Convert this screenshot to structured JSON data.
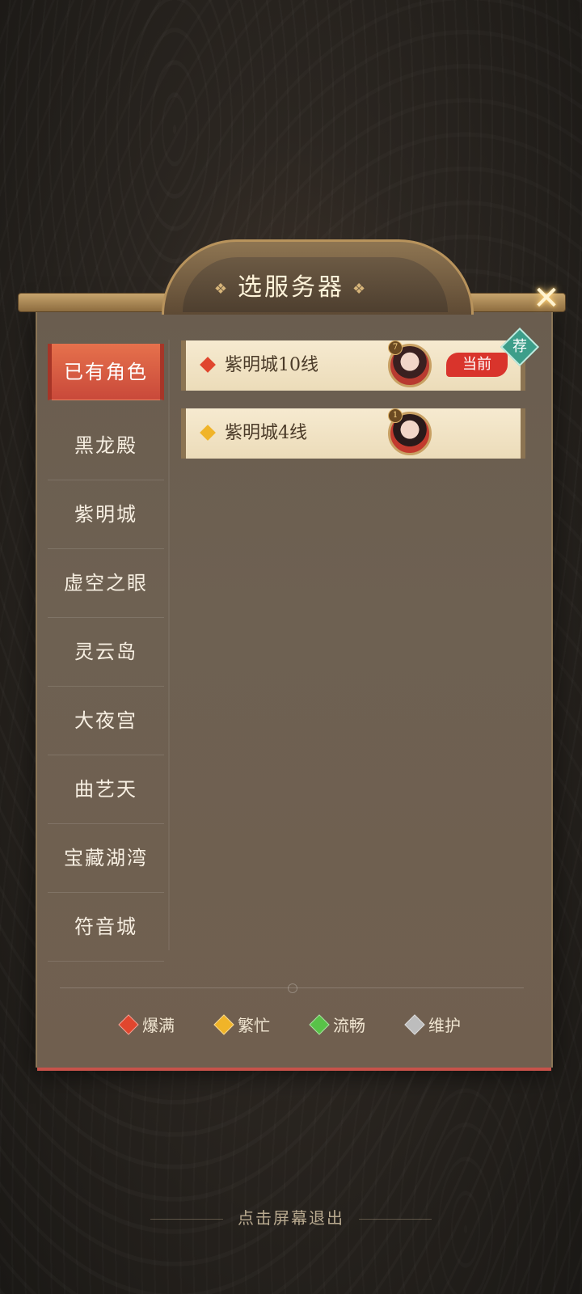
{
  "window": {
    "title": "选服务器"
  },
  "close_label": "✕",
  "sidebar": {
    "items": [
      {
        "label": "已有角色",
        "active": true
      },
      {
        "label": "黑龙殿"
      },
      {
        "label": "紫明城"
      },
      {
        "label": "虚空之眼"
      },
      {
        "label": "灵云岛"
      },
      {
        "label": "大夜宫"
      },
      {
        "label": "曲艺天"
      },
      {
        "label": "宝藏湖湾"
      },
      {
        "label": "符音城"
      }
    ]
  },
  "servers": [
    {
      "name": "紫明城10线",
      "status": "爆满",
      "status_color": "#e0462e",
      "level": "7",
      "badge": "当前"
    },
    {
      "name": "紫明城4线",
      "status": "繁忙",
      "status_color": "#f0b429",
      "level": "1"
    }
  ],
  "recommend_badge": "荐",
  "legend": [
    {
      "label": "爆满",
      "color": "#e0462e"
    },
    {
      "label": "繁忙",
      "color": "#f0b429"
    },
    {
      "label": "流畅",
      "color": "#58c248"
    },
    {
      "label": "维护",
      "color": "#bdbdbd"
    }
  ],
  "exit_hint": "点击屏幕退出"
}
